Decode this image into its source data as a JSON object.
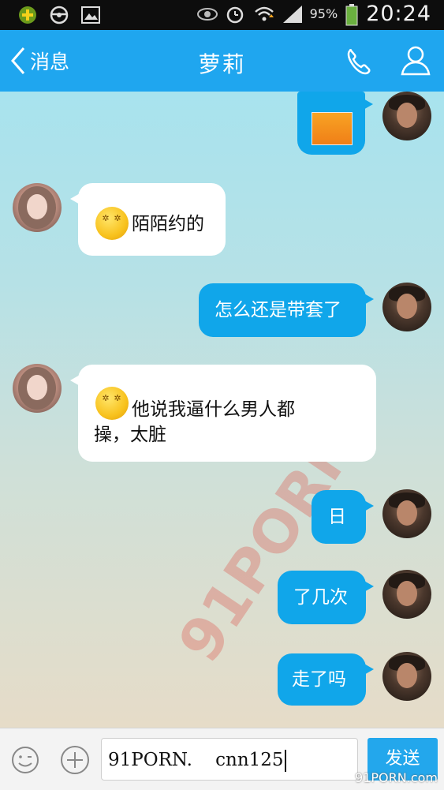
{
  "status_bar": {
    "battery": "95%",
    "time": "20:24",
    "icons": [
      "app-plus-icon",
      "steering-wheel-icon",
      "gallery-icon",
      "eye-icon",
      "alarm-icon",
      "wifi-icon",
      "signal-icon",
      "battery-icon"
    ]
  },
  "header": {
    "back_label": "消息",
    "title": "萝莉",
    "call_icon": "phone-icon",
    "profile_icon": "person-icon",
    "color": "#1fa6ef"
  },
  "messages": [
    {
      "from": "me",
      "type": "image",
      "text": ""
    },
    {
      "from": "contact",
      "type": "text",
      "emoji": "dizzy-smile-emoji",
      "text": "陌陌约的"
    },
    {
      "from": "me",
      "type": "text",
      "text": "怎么还是带套了"
    },
    {
      "from": "contact",
      "type": "text",
      "emoji": "dizzy-smile-emoji",
      "text_line1": "他说我逼什么男人都",
      "text_line2": "操，太脏"
    },
    {
      "from": "me",
      "type": "text",
      "text": "日"
    },
    {
      "from": "me",
      "type": "text",
      "text": "了几次"
    },
    {
      "from": "me",
      "type": "text",
      "text": "走了吗"
    }
  ],
  "watermark": "91PORN",
  "input_bar": {
    "emoji_icon": "smiley-face-icon",
    "plus_icon": "plus-icon",
    "input_value": "91PORN.    cnn125",
    "send_label": "发送"
  },
  "corner_watermark": "91PORN.com",
  "colors": {
    "outgoing_bubble": "#10a6ea",
    "incoming_bubble": "#ffffff",
    "send_button": "#23a7ec"
  }
}
